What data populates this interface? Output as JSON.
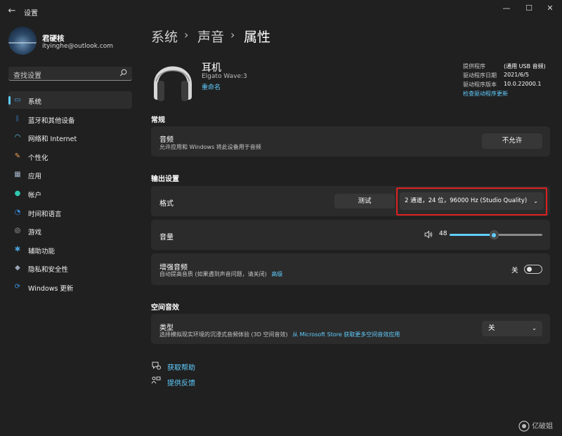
{
  "window": {
    "title": "设置",
    "back_icon": "←",
    "minimize_icon": "—",
    "maximize_icon": "☐",
    "close_icon": "✕"
  },
  "user": {
    "name": "君硬核",
    "email": "ityinghe@outlook.com"
  },
  "search": {
    "placeholder": "查找设置",
    "icon": "⌕"
  },
  "sidebar": {
    "items": [
      {
        "label": "系统",
        "icon": "▭",
        "color": "#4aa3df",
        "active": true
      },
      {
        "label": "蓝牙和其他设备",
        "icon": "ᛒ",
        "color": "#3a8fe0",
        "active": false
      },
      {
        "label": "网络和 Internet",
        "icon": "◠",
        "color": "#60cdff",
        "active": false
      },
      {
        "label": "个性化",
        "icon": "✎",
        "color": "#f0a05a",
        "active": false
      },
      {
        "label": "应用",
        "icon": "▦",
        "color": "#a5b4c8",
        "active": false
      },
      {
        "label": "帐户",
        "icon": "●",
        "color": "#2fc8b0",
        "active": false
      },
      {
        "label": "时间和语言",
        "icon": "◔",
        "color": "#3a8fe0",
        "active": false
      },
      {
        "label": "游戏",
        "icon": "◎",
        "color": "#b8b8b8",
        "active": false
      },
      {
        "label": "辅助功能",
        "icon": "✱",
        "color": "#4aa3df",
        "active": false
      },
      {
        "label": "隐私和安全性",
        "icon": "◆",
        "color": "#9aa6b4",
        "active": false
      },
      {
        "label": "Windows 更新",
        "icon": "⟳",
        "color": "#3a8fe0",
        "active": false
      }
    ]
  },
  "breadcrumb": {
    "items": [
      "系统",
      "声音",
      "属性"
    ],
    "separator": "›"
  },
  "device": {
    "name": "耳机",
    "model": "Elgato Wave:3",
    "rename": "重命名",
    "info": {
      "provider_label": "提供程序",
      "provider_value": "(通用 USB 音频)",
      "date_label": "驱动程序日期",
      "date_value": "2021/6/5",
      "version_label": "驱动程序版本",
      "version_value": "10.0.22000.1",
      "check_link": "检查驱动程序更新"
    }
  },
  "general": {
    "heading": "常规",
    "audio_title": "音频",
    "audio_sub": "允许应用和 Windows 将此设备用于音频",
    "audio_button": "不允许"
  },
  "output": {
    "heading": "输出设置",
    "format_title": "格式",
    "test_button": "测试",
    "format_value": "2 通道，24 位，96000 Hz (Studio Quality)",
    "volume_title": "音量",
    "volume_value": "48",
    "volume_level_percent": 48,
    "enhance_title": "增强音频",
    "enhance_sub": "自动提高音质 (如果遇到声音问题，请关闭)",
    "enhance_link": "高级",
    "enhance_state": "关"
  },
  "spatial": {
    "heading": "空间音效",
    "type_title": "类型",
    "type_sub": "选择模拟现实环境的沉浸式音频体验 (3D 空间音效)",
    "type_link": "从 Microsoft Store 获取更多空间音效应用",
    "type_value": "关"
  },
  "help": {
    "get_help": "获取帮助",
    "feedback": "提供反馈"
  },
  "colors": {
    "accent": "#60cdff",
    "highlight_box": "#e02020"
  },
  "watermark": "亿破姐"
}
